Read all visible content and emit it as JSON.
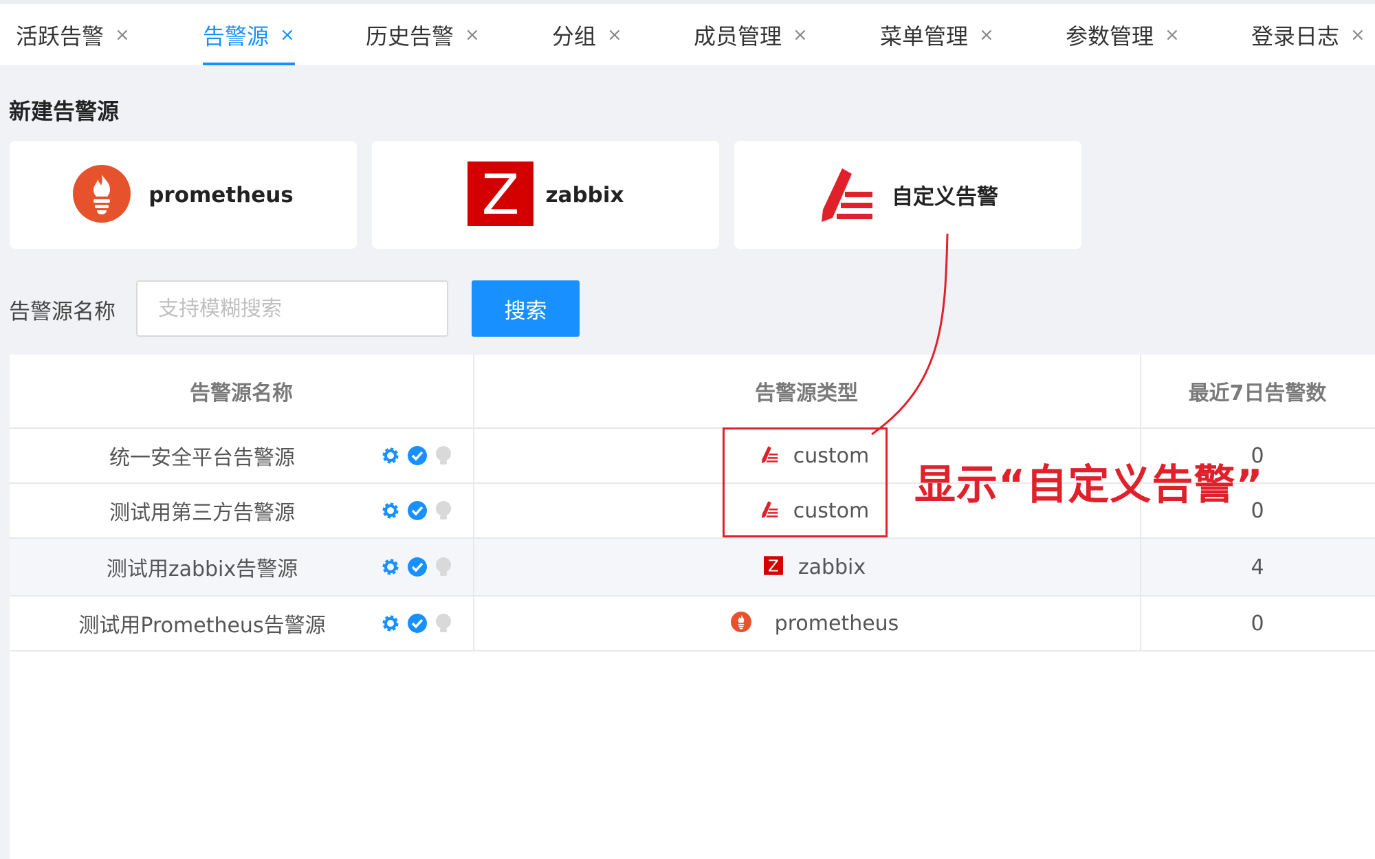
{
  "tabs": [
    {
      "label": "活跃告警",
      "active": false
    },
    {
      "label": "告警源",
      "active": true
    },
    {
      "label": "历史告警",
      "active": false
    },
    {
      "label": "分组",
      "active": false
    },
    {
      "label": "成员管理",
      "active": false
    },
    {
      "label": "菜单管理",
      "active": false
    },
    {
      "label": "参数管理",
      "active": false
    },
    {
      "label": "登录日志",
      "active": false
    }
  ],
  "tab_close_glyph": "×",
  "section_title": "新建告警源",
  "cards": [
    {
      "label": "prometheus",
      "icon": "prometheus-icon"
    },
    {
      "label": "zabbix",
      "icon": "zabbix-icon"
    },
    {
      "label": "自定义告警",
      "icon": "custom-alert-icon"
    }
  ],
  "search": {
    "label": "告警源名称",
    "placeholder": "支持模糊搜索",
    "button_label": "搜索"
  },
  "table": {
    "headers": [
      "告警源名称",
      "告警源类型",
      "最近7日告警数"
    ],
    "rows": [
      {
        "name": "统一安全平台告警源",
        "type": "custom",
        "count": "0"
      },
      {
        "name": "测试用第三方告警源",
        "type": "custom",
        "count": "0"
      },
      {
        "name": "测试用zabbix告警源",
        "type": "zabbix",
        "count": "4"
      },
      {
        "name": "测试用Prometheus告警源",
        "type": "prometheus",
        "count": "0"
      }
    ],
    "row_actions": [
      "settings-icon",
      "enabled-check-icon",
      "status-bulb-icon"
    ]
  },
  "annotation": {
    "text": "显示“自定义告警”",
    "color": "#e0202a"
  },
  "colors": {
    "accent": "#1890ff",
    "prometheus": "#e6522c",
    "zabbix": "#d40000",
    "custom": "#e0202a"
  }
}
